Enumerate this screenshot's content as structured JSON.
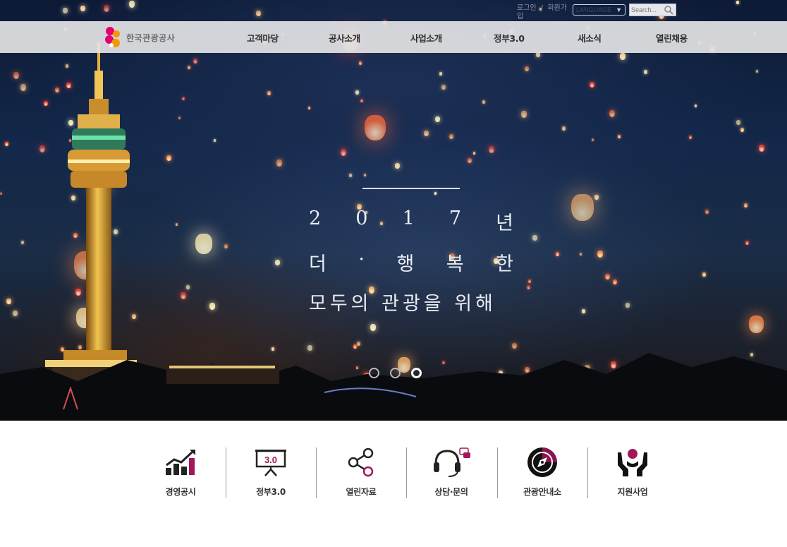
{
  "header": {
    "login_label": "로그인",
    "divider": "/",
    "signup_label": "회원가입",
    "language_label": "LANGUAGE",
    "search_placeholder": "Search...",
    "brand_colors": {
      "nav_bg": "#e2e2e4",
      "accent": "#e4006e"
    }
  },
  "logo": {
    "text": "한국관광공사",
    "icon": "kto-logo-icon"
  },
  "nav": {
    "items": [
      {
        "label": "고객마당"
      },
      {
        "label": "공사소개"
      },
      {
        "label": "사업소개"
      },
      {
        "label": "정부3.0"
      },
      {
        "label": "새소식"
      },
      {
        "label": "열린채용"
      }
    ]
  },
  "hero": {
    "line1": [
      "2",
      "0",
      "1",
      "7",
      "년"
    ],
    "line2": [
      "더",
      "·",
      "행",
      "복",
      "한"
    ],
    "line3": "모두의 관광을 위해",
    "slides": 3,
    "active_slide": 3
  },
  "quick_links": [
    {
      "label": "경영공시",
      "icon": "chart-growth-icon"
    },
    {
      "label": "정부3.0",
      "icon": "presentation-board-icon"
    },
    {
      "label": "열린자료",
      "icon": "share-icon"
    },
    {
      "label": "상담·문의",
      "icon": "headset-chat-icon"
    },
    {
      "label": "관광안내소",
      "icon": "compass-icon"
    },
    {
      "label": "지원사업",
      "icon": "hands-support-icon"
    }
  ]
}
